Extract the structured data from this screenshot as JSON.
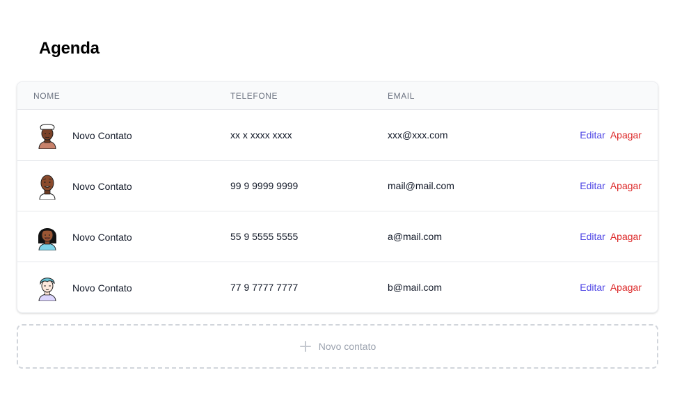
{
  "page": {
    "title": "Agenda"
  },
  "table": {
    "headers": {
      "name": "NOME",
      "phone": "TELEFONE",
      "email": "EMAIL"
    },
    "rows": [
      {
        "avatar": "avatar-chef-icon",
        "name": "Novo Contato",
        "phone": "xx x xxxx xxxx",
        "email": "xxx@xxx.com",
        "edit": "Editar",
        "delete": "Apagar"
      },
      {
        "avatar": "avatar-bald-man-icon",
        "name": "Novo Contato",
        "phone": "99 9 9999 9999",
        "email": "mail@mail.com",
        "edit": "Editar",
        "delete": "Apagar"
      },
      {
        "avatar": "avatar-woman-icon",
        "name": "Novo Contato",
        "phone": "55 9 5555 5555",
        "email": "a@mail.com",
        "edit": "Editar",
        "delete": "Apagar"
      },
      {
        "avatar": "avatar-blue-hair-icon",
        "name": "Novo Contato",
        "phone": "77 9 7777 7777",
        "email": "b@mail.com",
        "edit": "Editar",
        "delete": "Apagar"
      }
    ]
  },
  "new_contact": {
    "label": "Novo contato",
    "icon": "plus-icon"
  },
  "colors": {
    "edit": "#4f46e5",
    "delete": "#dc2626",
    "header_bg": "#f9fafb",
    "muted": "#9ca3af"
  }
}
